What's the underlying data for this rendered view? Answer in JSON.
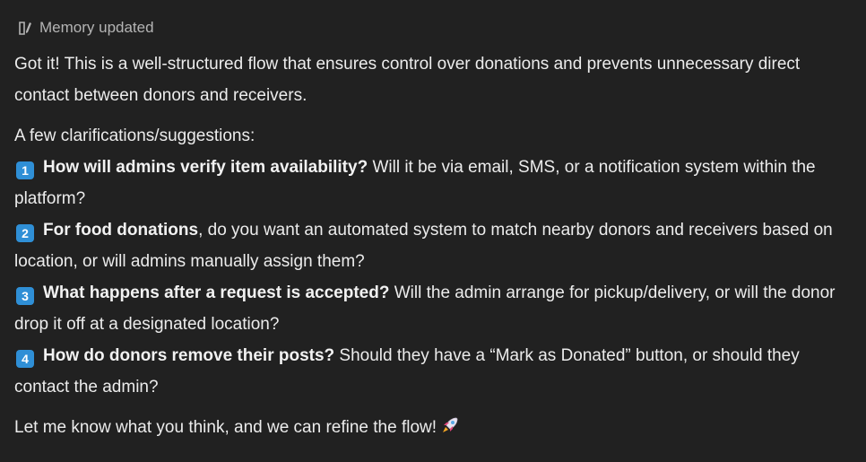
{
  "memory": {
    "icon": "memory-pen-icon",
    "label": "Memory updated"
  },
  "message": {
    "intro": "Got it! This is a well-structured flow that ensures control over donations and prevents unnecessary direct contact between donors and receivers.",
    "lead": "A few clarifications/suggestions:",
    "items": [
      {
        "number": "1",
        "bold": "How will admins verify item availability?",
        "rest": " Will it be via email, SMS, or a notification system within the platform?"
      },
      {
        "number": "2",
        "bold": "For food donations",
        "rest": ", do you want an automated system to match nearby donors and receivers based on location, or will admins manually assign them?"
      },
      {
        "number": "3",
        "bold": "What happens after a request is accepted?",
        "rest": " Will the admin arrange for pickup/delivery, or will the donor drop it off at a designated location?"
      },
      {
        "number": "4",
        "bold": "How do donors remove their posts?",
        "rest": " Should they have a “Mark as Donated” button, or should they contact the admin?"
      }
    ],
    "closing": "Let me know what you think, and we can refine the flow!",
    "closing_icon": "rocket-icon"
  },
  "colors": {
    "background": "#212121",
    "text": "#ececec",
    "muted": "#b4b4b4",
    "badge": "#2f8fd6"
  }
}
